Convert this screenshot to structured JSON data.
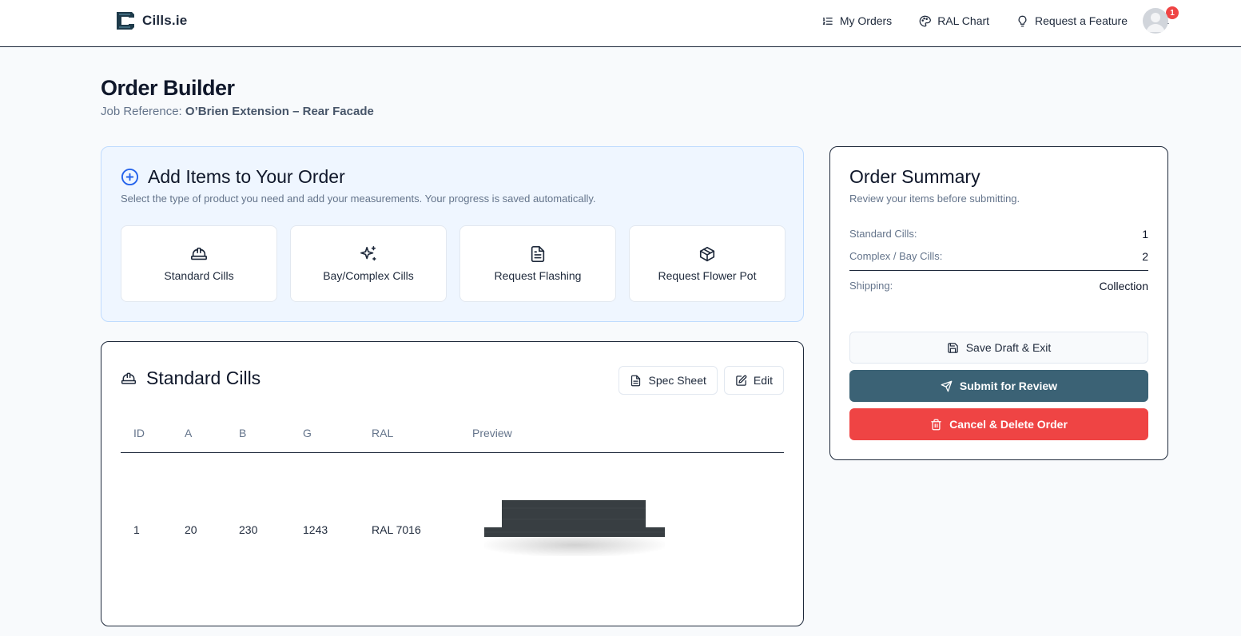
{
  "header": {
    "brand": "Cills.ie",
    "nav": [
      {
        "label": "My Orders",
        "icon": "list-ordered-icon"
      },
      {
        "label": "RAL Chart",
        "icon": "palette-icon"
      },
      {
        "label": "Request a Feature",
        "icon": "lightbulb-icon"
      }
    ],
    "notification_count": "1"
  },
  "page": {
    "title": "Order Builder",
    "job_ref_label": "Job Reference:",
    "job_ref_value": "O’Brien Extension – Rear Facade"
  },
  "add_items": {
    "title": "Add Items to Your Order",
    "subtitle": "Select the type of product you need and add your measurements. Your progress is saved automatically.",
    "tiles": [
      {
        "label": "Standard Cills",
        "icon": "hard-hat-icon"
      },
      {
        "label": "Bay/Complex Cills",
        "icon": "sparkles-icon"
      },
      {
        "label": "Request Flashing",
        "icon": "file-text-icon"
      },
      {
        "label": "Request Flower Pot",
        "icon": "package-icon"
      }
    ]
  },
  "standard_cills": {
    "title": "Standard Cills",
    "spec_sheet_label": "Spec Sheet",
    "edit_label": "Edit",
    "columns": [
      "ID",
      "A",
      "B",
      "G",
      "RAL",
      "Preview"
    ],
    "rows": [
      {
        "id": "1",
        "a": "20",
        "b": "230",
        "g": "1243",
        "ral": "RAL 7016"
      }
    ],
    "preview_color": "#383e42"
  },
  "summary": {
    "title": "Order Summary",
    "subtitle": "Review your items before submitting.",
    "lines": [
      {
        "label": "Standard Cills:",
        "value": "1"
      },
      {
        "label": "Complex / Bay Cills:",
        "value": "2"
      }
    ],
    "shipping_label": "Shipping:",
    "shipping_value": "Collection",
    "save_draft_label": "Save Draft & Exit",
    "submit_label": "Submit for Review",
    "cancel_label": "Cancel & Delete Order"
  },
  "colors": {
    "accent": "#3b6275",
    "danger": "#ef4444",
    "info_bg": "#eff6ff",
    "info_border": "#bfdbfe"
  }
}
